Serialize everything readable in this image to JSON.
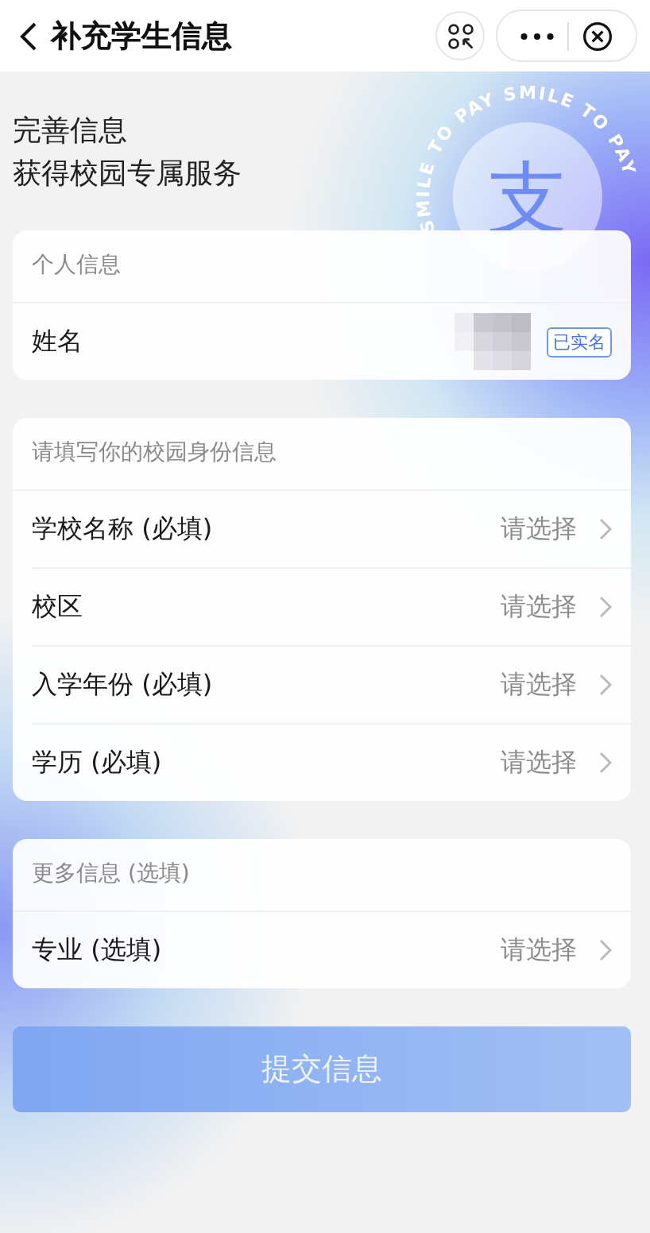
{
  "nav": {
    "title": "补充学生信息"
  },
  "intro": [
    "完善信息",
    "获得校园专属服务"
  ],
  "emblem": {
    "glyph": "支",
    "ring_text": "SMILE TO PAY SMILE TO PAY"
  },
  "sections": [
    {
      "header": "个人信息",
      "rows": [
        {
          "kind": "verified",
          "label": "姓名",
          "badge": "已实名"
        }
      ]
    },
    {
      "header": "请填写你的校园身份信息",
      "rows": [
        {
          "kind": "select",
          "label": "学校名称 (必填)",
          "value": "请选择"
        },
        {
          "kind": "select",
          "label": "校区",
          "value": "请选择"
        },
        {
          "kind": "select",
          "label": "入学年份 (必填)",
          "value": "请选择"
        },
        {
          "kind": "select",
          "label": "学历 (必填)",
          "value": "请选择"
        }
      ]
    },
    {
      "header": "更多信息 (选填)",
      "rows": [
        {
          "kind": "select",
          "label": "专业 (选填)",
          "value": "请选择"
        }
      ]
    }
  ],
  "submit": {
    "label": "提交信息",
    "disabled": true
  }
}
